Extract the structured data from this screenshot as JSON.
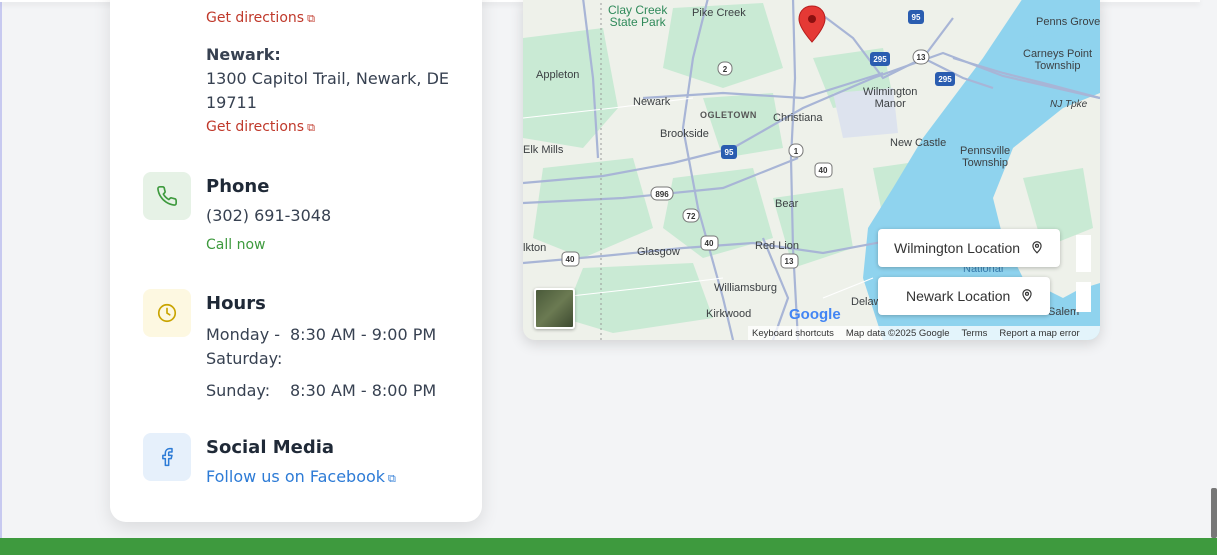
{
  "locations": [
    {
      "directions_label": "Get directions"
    },
    {
      "name": "Newark:",
      "address_line1": "1300 Capitol Trail, Newark, DE",
      "address_line2": "19711",
      "directions_label": "Get directions"
    }
  ],
  "phone": {
    "heading": "Phone",
    "number": "(302) 691-3048",
    "call_label": "Call now",
    "icon": "phone-icon"
  },
  "hours": {
    "heading": "Hours",
    "rows": [
      {
        "day_line1": "Monday -",
        "day_line2": "Saturday:",
        "time": "8:30 AM - 9:00 PM"
      },
      {
        "day_line1": "Sunday:",
        "time": "8:30 AM - 8:00 PM"
      }
    ],
    "icon": "clock-icon"
  },
  "social": {
    "heading": "Social Media",
    "facebook_label": "Follow us on Facebook",
    "icon": "facebook-icon"
  },
  "map": {
    "places": {
      "clay_creek_1": "Clay Creek",
      "clay_creek_2": "State Park",
      "pike_creek": "Pike Creek",
      "appleton": "Appleton",
      "newark": "Newark",
      "ogletown": "OGLETOWN",
      "christiana": "Christiana",
      "wilmington_manor_1": "Wilmington",
      "wilmington_manor_2": "Manor",
      "brookside": "Brookside",
      "elk_mills": "Elk Mills",
      "new_castle": "New Castle",
      "pennsville_1": "Pennsville",
      "pennsville_2": "Township",
      "penns_grove": "Penns Grove",
      "carneys_point_1": "Carneys Point",
      "carneys_point_2": "Township",
      "nj_tpke": "NJ Tpke",
      "bear": "Bear",
      "glasgow": "Glasgow",
      "red_lion": "Red Lion",
      "elkton": "lkton",
      "williamsburg": "Williamsburg",
      "kirkwood": "Kirkwood",
      "delaware": "Delaw",
      "national": "National",
      "salem": "Salem"
    },
    "shields": {
      "i95_a": "95",
      "i295_a": "295",
      "r13_a": "13",
      "i295_b": "295",
      "r2": "2",
      "i95_b": "95",
      "r1": "1",
      "r40_a": "40",
      "r896": "896",
      "r72": "72",
      "r40_b": "40",
      "r40_c": "40",
      "r13_b": "13"
    },
    "buttons": {
      "wilmington": "Wilmington Location",
      "newark": "Newark Location"
    },
    "google": "Google",
    "attribution": {
      "shortcuts": "Keyboard shortcuts",
      "data": "Map data ©2025 Google",
      "terms": "Terms",
      "report": "Report a map error"
    }
  },
  "colors": {
    "footer": "#3e9a3e",
    "link_red": "#c0392b",
    "link_green": "#3e9a3e",
    "link_blue": "#2d7bd6",
    "marker": "#e53935",
    "water": "#8fd3ee"
  }
}
